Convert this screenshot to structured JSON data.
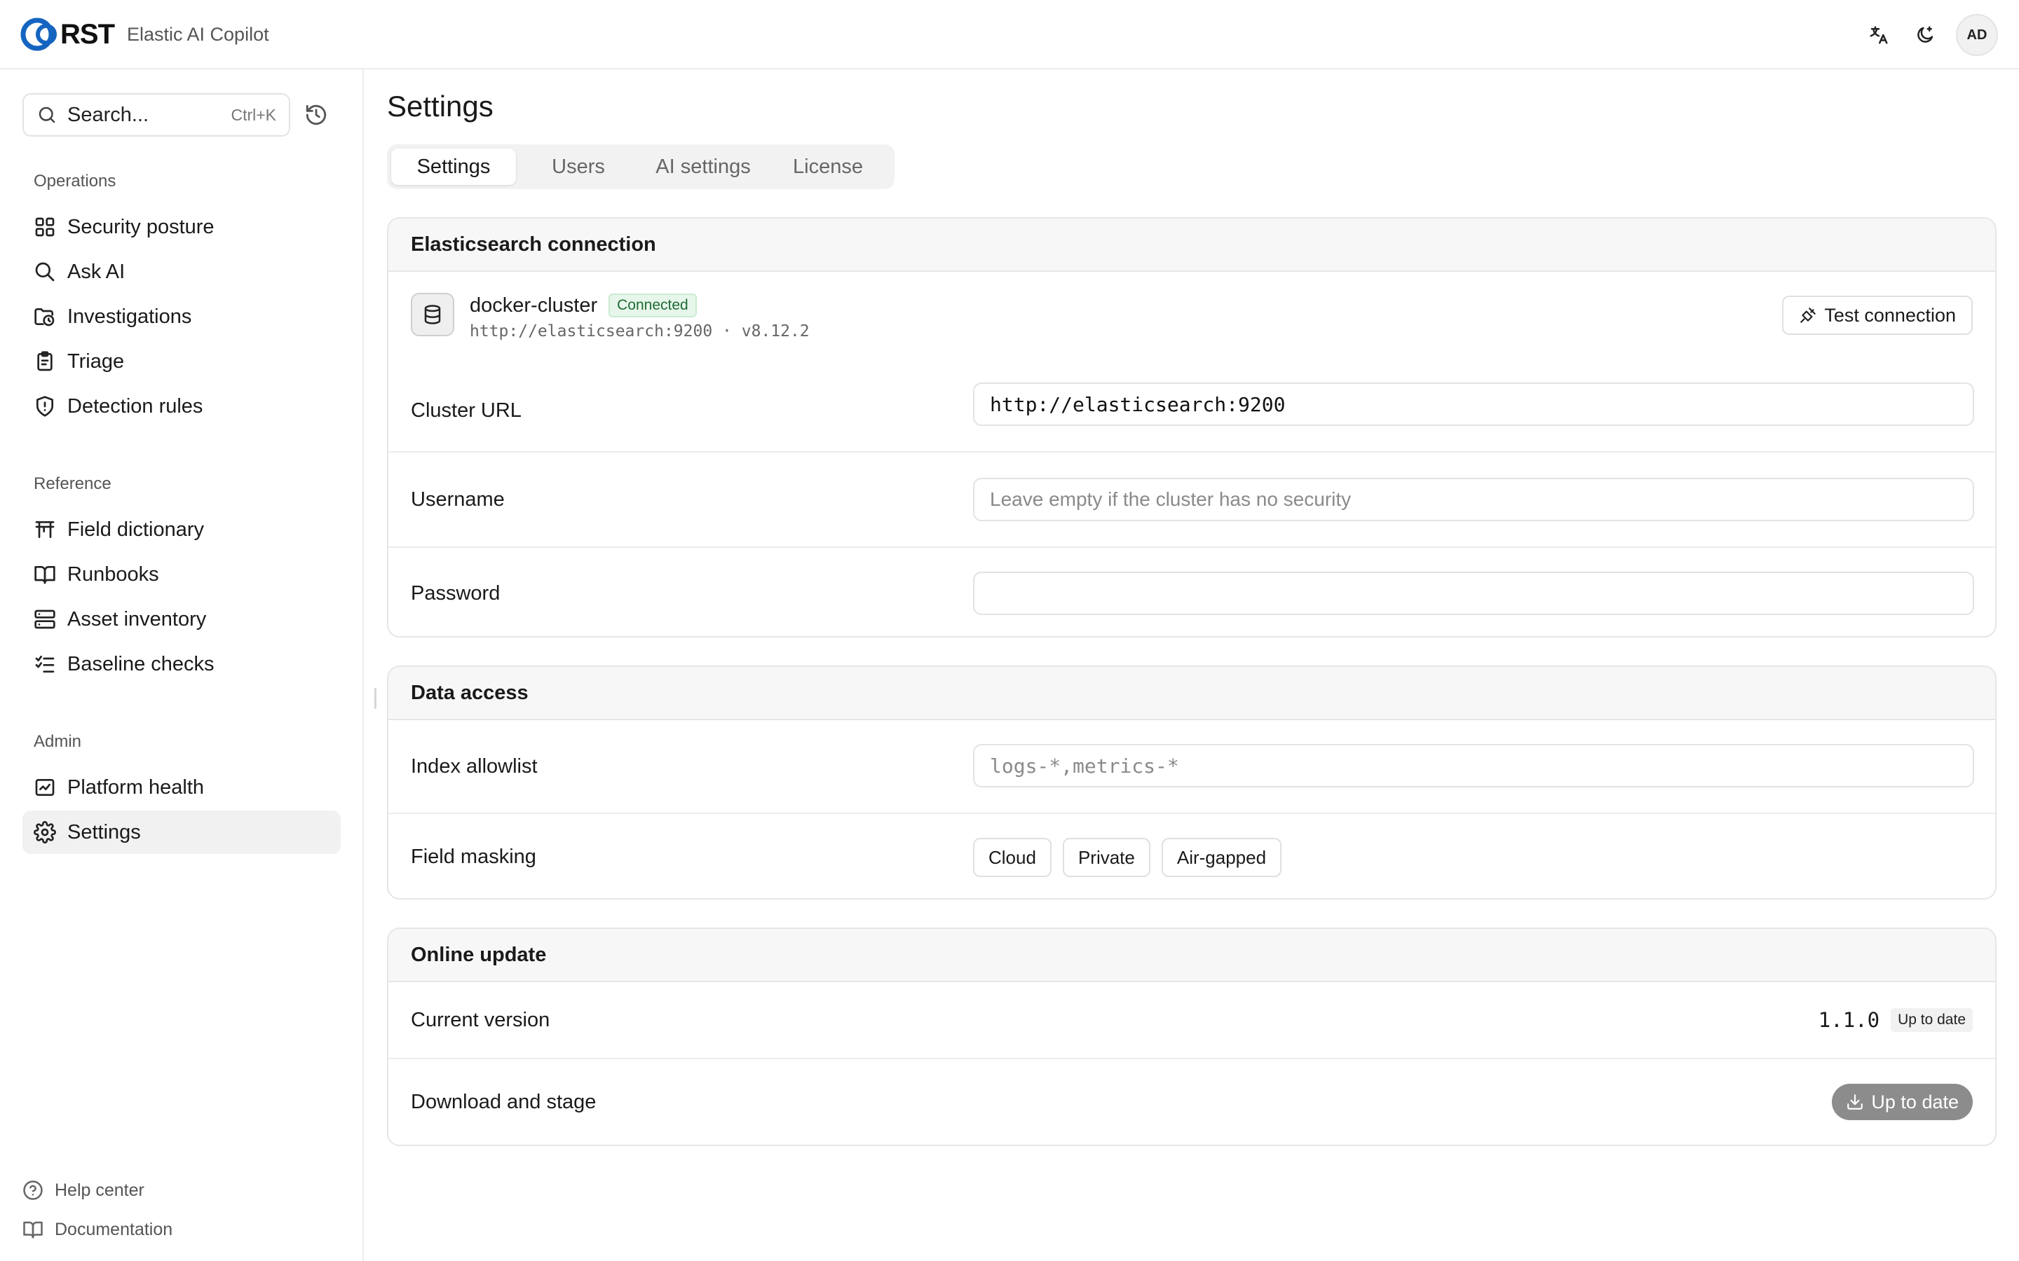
{
  "header": {
    "logo_text": "RST",
    "app_name": "Elastic AI Copilot",
    "avatar_initials": "AD",
    "icons": [
      "translate-icon",
      "theme-toggle-icon"
    ]
  },
  "sidebar": {
    "search": {
      "label": "Search...",
      "shortcut": "Ctrl+K"
    },
    "sections": [
      {
        "title": "Operations",
        "items": [
          {
            "label": "Security posture",
            "icon": "grid-icon"
          },
          {
            "label": "Ask AI",
            "icon": "search-icon"
          },
          {
            "label": "Investigations",
            "icon": "folder-clock-icon"
          },
          {
            "label": "Triage",
            "icon": "clipboard-icon"
          },
          {
            "label": "Detection rules",
            "icon": "shield-alert-icon"
          }
        ]
      },
      {
        "title": "Reference",
        "items": [
          {
            "label": "Field dictionary",
            "icon": "table-icon"
          },
          {
            "label": "Runbooks",
            "icon": "book-open-icon"
          },
          {
            "label": "Asset inventory",
            "icon": "server-icon"
          },
          {
            "label": "Baseline checks",
            "icon": "list-checks-icon"
          }
        ]
      },
      {
        "title": "Admin",
        "items": [
          {
            "label": "Platform health",
            "icon": "activity-icon"
          },
          {
            "label": "Settings",
            "icon": "gear-icon",
            "active": true
          }
        ]
      }
    ],
    "footer": [
      {
        "label": "Help center",
        "icon": "help-circle-icon"
      },
      {
        "label": "Documentation",
        "icon": "book-icon"
      }
    ]
  },
  "main": {
    "title": "Settings",
    "tabs": [
      {
        "label": "Settings",
        "active": true
      },
      {
        "label": "Users"
      },
      {
        "label": "AI settings"
      },
      {
        "label": "License"
      }
    ],
    "elasticsearch": {
      "title": "Elasticsearch connection",
      "cluster_name": "docker-cluster",
      "status": "Connected",
      "cluster_meta": "http://elasticsearch:9200 · v8.12.2",
      "test_button": "Test connection",
      "cluster_url_label": "Cluster URL",
      "cluster_url_value": "http://elasticsearch:9200",
      "username_label": "Username",
      "username_placeholder": "Leave empty if the cluster has no security",
      "password_label": "Password",
      "password_value": ""
    },
    "data_access": {
      "title": "Data access",
      "index_label": "Index allowlist",
      "index_placeholder": "logs-*,metrics-*",
      "masking_label": "Field masking",
      "masking_options": [
        "Cloud",
        "Private",
        "Air-gapped"
      ]
    },
    "online_update": {
      "title": "Online update",
      "current_label": "Current version",
      "current_version": "1.1.0",
      "current_status": "Up to date",
      "download_label": "Download and stage",
      "download_button": "Up to date"
    }
  },
  "colors": {
    "connected_badge": "#e7f6ea",
    "active_nav_bg": "#f1f1f1",
    "disabled_button": "#8c8c8c",
    "logo_accent": "#1565c0"
  }
}
